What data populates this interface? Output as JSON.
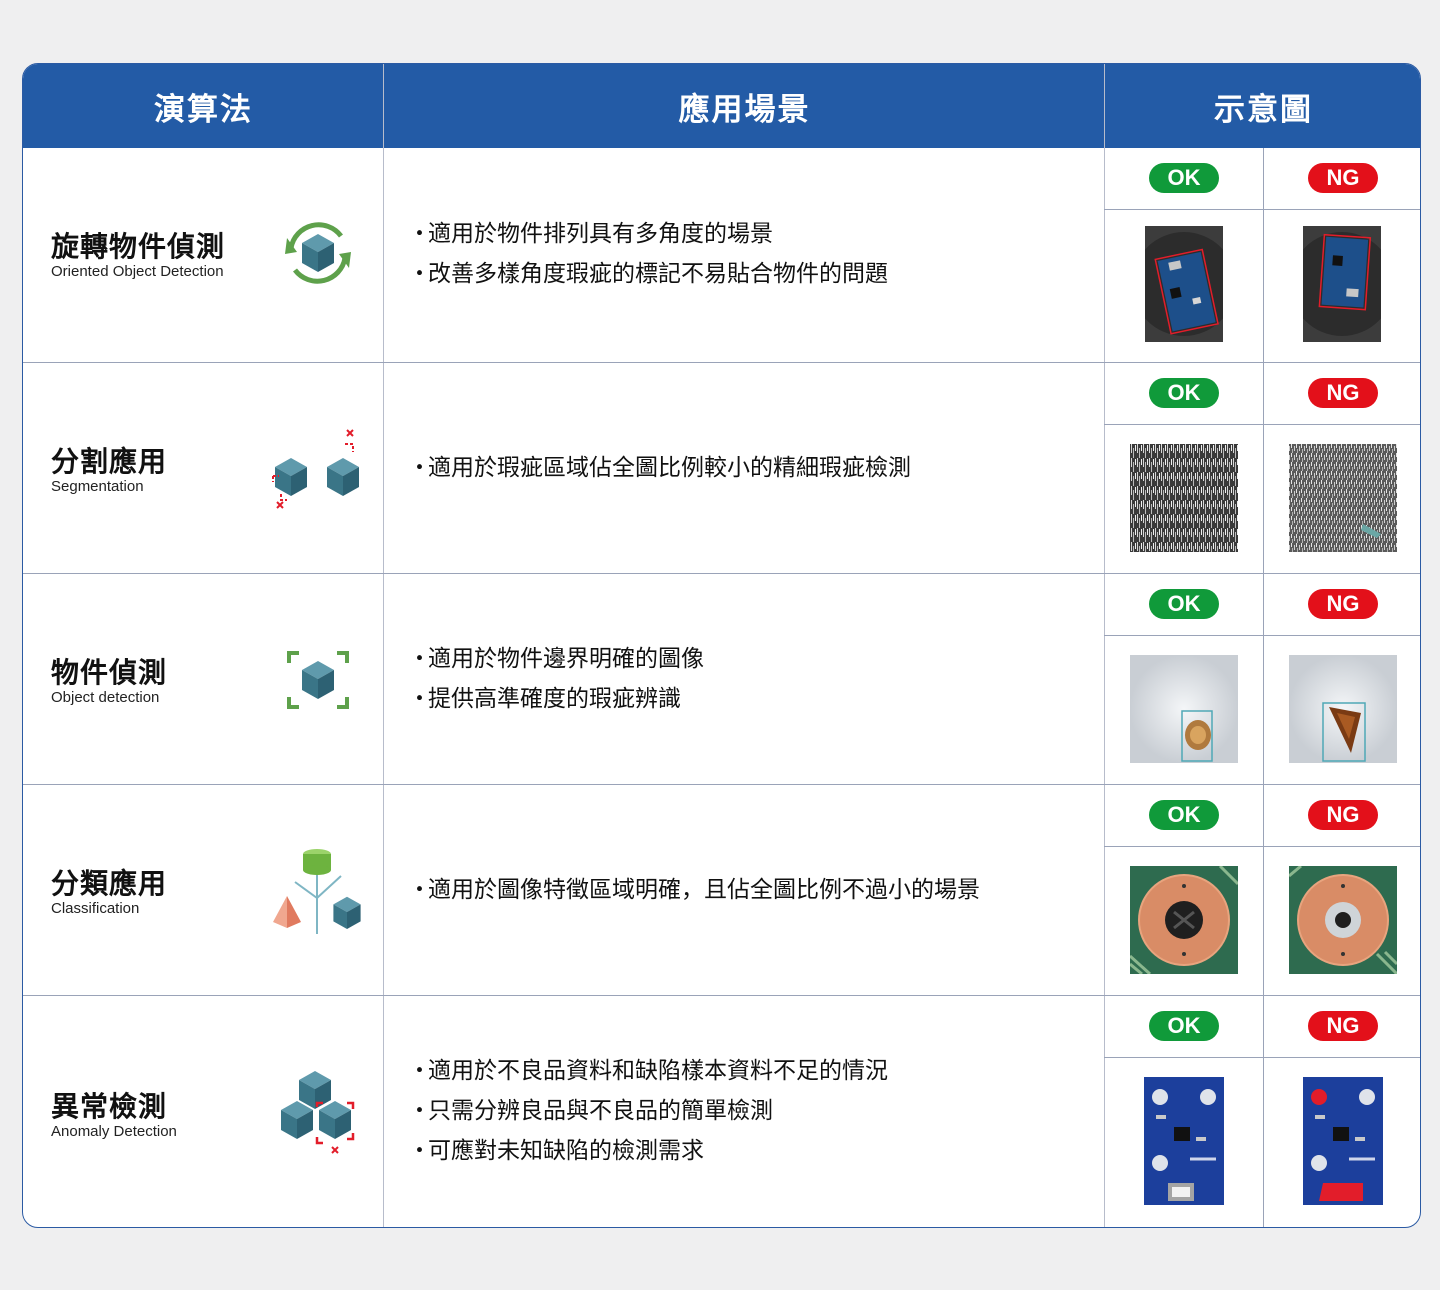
{
  "header": {
    "col_algorithm": "演算法",
    "col_scenario": "應用場景",
    "col_illustration": "示意圖"
  },
  "badges": {
    "ok": "OK",
    "ng": "NG"
  },
  "colors": {
    "header_bg": "#235ba6",
    "ok": "#109a3a",
    "ng": "#e3101a",
    "icon_green": "#5ea14b",
    "cube": "#3f7d8f",
    "marker_red": "#e21d2a"
  },
  "rows": [
    {
      "name_zh": "旋轉物件偵測",
      "name_en": "Oriented Object Detection",
      "icon": "rotate-cube-icon",
      "bullets": [
        "適用於物件排列具有多角度的場景",
        "改善多樣角度瑕疵的標記不易貼合物件的問題"
      ]
    },
    {
      "name_zh": "分割應用",
      "name_en": "Segmentation",
      "icon": "segment-cubes-icon",
      "bullets": [
        "適用於瑕疵區域佔全圖比例較小的精細瑕疵檢測"
      ]
    },
    {
      "name_zh": "物件偵測",
      "name_en": "Object detection",
      "icon": "detect-cube-icon",
      "bullets": [
        "適用於物件邊界明確的圖像",
        "提供高準確度的瑕疵辨識"
      ]
    },
    {
      "name_zh": "分類應用",
      "name_en": "Classification",
      "icon": "classify-shapes-icon",
      "bullets": [
        "適用於圖像特徵區域明確，且佔全圖比例不過小的場景"
      ]
    },
    {
      "name_zh": "異常檢測",
      "name_en": "Anomaly Detection",
      "icon": "anomaly-cubes-icon",
      "bullets": [
        "適用於不良品資料和缺陷樣本資料不足的情況",
        "只需分辨良品與不良品的簡單檢測",
        "可應對未知缺陷的檢測需求"
      ]
    }
  ]
}
